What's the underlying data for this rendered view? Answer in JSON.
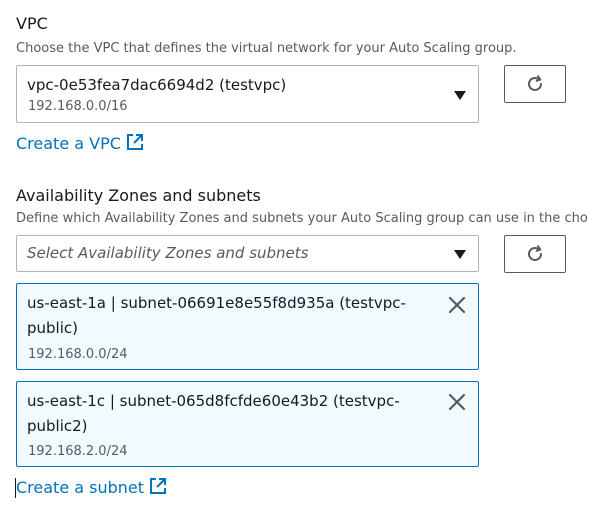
{
  "vpc": {
    "label": "VPC",
    "description": "Choose the VPC that defines the virtual network for your Auto Scaling group.",
    "selected": "vpc-0e53fea7dac6694d2 (testvpc)",
    "cidr": "192.168.0.0/16",
    "refresh_icon": "refresh-icon",
    "dropdown_icon": "caret-down-icon",
    "create_link": "Create a VPC",
    "create_link_icon": "external-link-icon"
  },
  "subnets": {
    "label": "Availability Zones and subnets",
    "description": "Define which Availability Zones and subnets your Auto Scaling group can use in the cho",
    "placeholder": "Select Availability Zones and subnets",
    "refresh_icon": "refresh-icon",
    "dropdown_icon": "caret-down-icon",
    "selected": [
      {
        "name": "us-east-1a | subnet-06691e8e55f8d935a (testvpc-public)",
        "cidr": "192.168.0.0/24"
      },
      {
        "name": "us-east-1c | subnet-065d8fcfde60e43b2 (testvpc-public2)",
        "cidr": "192.168.2.0/24"
      }
    ],
    "create_link": "Create a subnet",
    "create_link_icon": "external-link-icon"
  },
  "colors": {
    "link": "#0073bb",
    "token_border": "#0073bb",
    "token_background": "#f1faff",
    "text": "#16191f",
    "secondary_text": "#545b64",
    "input_border": "#aab7b8"
  }
}
